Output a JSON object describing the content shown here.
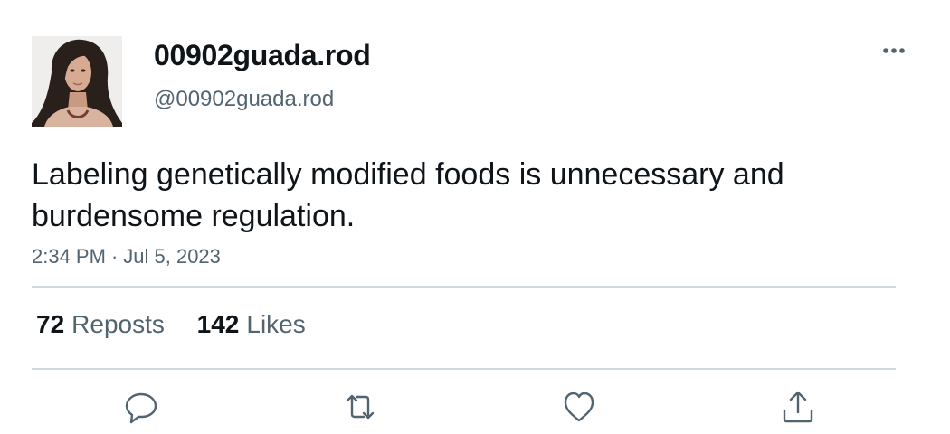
{
  "user": {
    "display_name": "00902guada.rod",
    "handle": "@00902guada.rod",
    "avatar_icon": "avatar-photo"
  },
  "post": {
    "text": "Labeling genetically modified foods is unnecessary and burdensome regulation.",
    "time": "2:34 PM",
    "separator": "·",
    "date": "Jul 5, 2023"
  },
  "stats": {
    "reposts_count": "72",
    "reposts_label": "Reposts",
    "likes_count": "142",
    "likes_label": "Likes"
  },
  "actions": {
    "more_icon": "more-icon",
    "reply_icon": "reply-icon",
    "repost_icon": "repost-icon",
    "like_icon": "like-icon",
    "share_icon": "share-icon"
  },
  "colors": {
    "text_primary": "#0f1419",
    "text_secondary": "#536471",
    "divider": "#cfd9de"
  }
}
